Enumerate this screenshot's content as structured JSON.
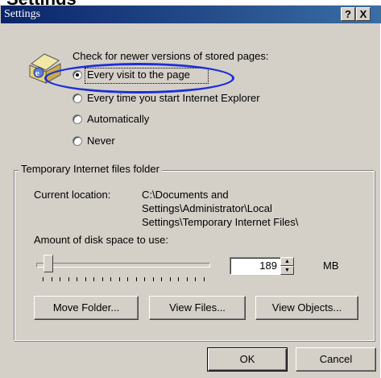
{
  "header_fragment": "Settings",
  "window": {
    "title": "Settings",
    "help_button": "?",
    "close_button": "X"
  },
  "check_section": {
    "heading": "Check for newer versions of stored pages:",
    "options": [
      {
        "label": "Every visit to the page",
        "selected": true
      },
      {
        "label": "Every time you start Internet Explorer",
        "selected": false
      },
      {
        "label": "Automatically",
        "selected": false
      },
      {
        "label": "Never",
        "selected": false
      }
    ]
  },
  "temp_folder": {
    "group_title": "Temporary Internet files folder",
    "current_location_label": "Current location:",
    "current_location_lines": [
      "C:\\Documents and",
      "Settings\\Administrator\\Local",
      "Settings\\Temporary Internet Files\\"
    ],
    "disk_space_label": "Amount of disk space to use:",
    "disk_space_value": "189",
    "disk_space_unit": "MB",
    "slider_level": 0.04,
    "buttons": {
      "move_folder": "Move Folder...",
      "view_files": "View Files...",
      "view_objects": "View Objects..."
    }
  },
  "dialog_buttons": {
    "ok": "OK",
    "cancel": "Cancel"
  },
  "colors": {
    "dialog_face": "#d4d0c8",
    "titlebar": "#0a246a",
    "annotation_ellipse": "#1c2fd8"
  }
}
